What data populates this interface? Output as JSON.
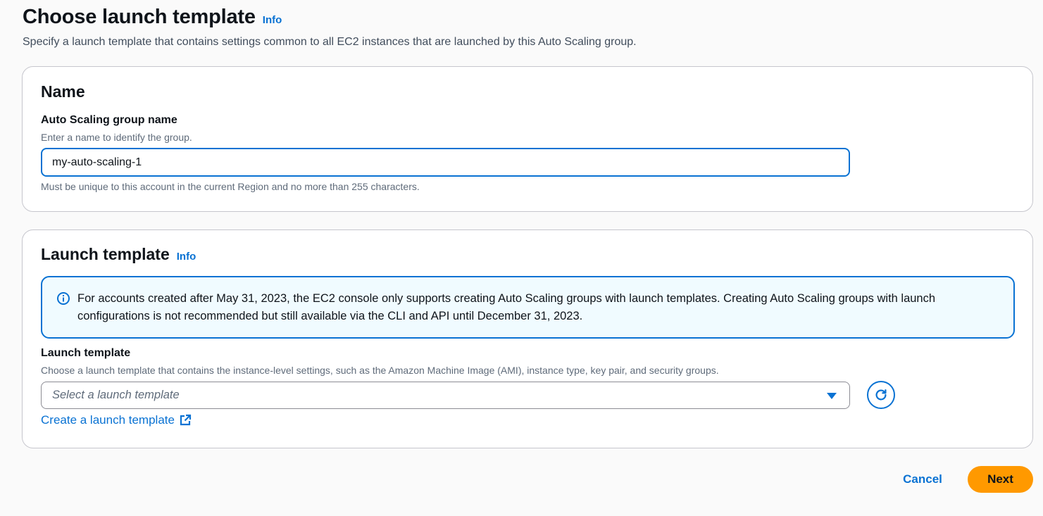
{
  "page": {
    "title": "Choose launch template",
    "info_label": "Info",
    "description": "Specify a launch template that contains settings common to all EC2 instances that are launched by this Auto Scaling group."
  },
  "name_section": {
    "title": "Name",
    "asg_name_label": "Auto Scaling group name",
    "asg_name_description": "Enter a name to identify the group.",
    "asg_name_value": "my-auto-scaling-1",
    "asg_name_constraint": "Must be unique to this account in the current Region and no more than 255 characters."
  },
  "launch_section": {
    "title": "Launch template",
    "info_label": "Info",
    "alert_icon": "info-circle-icon",
    "alert_text": "For accounts created after May 31, 2023, the EC2 console only supports creating Auto Scaling groups with launch templates. Creating Auto Scaling groups with launch configurations is not recommended but still available via the CLI and API until December 31, 2023.",
    "template_label": "Launch template",
    "template_description": "Choose a launch template that contains the instance-level settings, such as the Amazon Machine Image (AMI), instance type, key pair, and security groups.",
    "template_placeholder": "Select a launch template",
    "refresh_icon": "refresh-icon",
    "create_link": "Create a launch template",
    "external_icon": "external-link-icon"
  },
  "footer": {
    "cancel_label": "Cancel",
    "next_label": "Next"
  },
  "colors": {
    "accent": "#0972d3",
    "primary_button": "#ff9900",
    "alert_background": "#f0fbff"
  }
}
